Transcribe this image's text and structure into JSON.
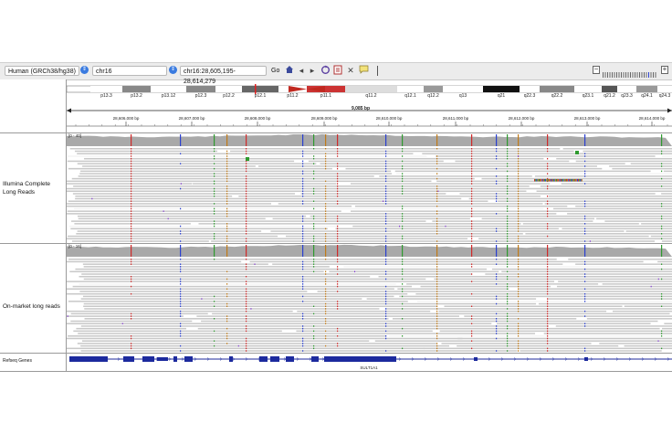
{
  "toolbar": {
    "genome": "Human (GRCh38/hg38)",
    "chromosome": "chr16",
    "locus": "chr16:28,605,195-28,614,279",
    "go_label": "Go"
  },
  "ideogram": {
    "bands": [
      "p13.3",
      "p13.2",
      "p13.12",
      "p12.3",
      "p12.2",
      "p12.1",
      "p11.2",
      "p11.1",
      "q11.2",
      "q12.1",
      "q12.2",
      "q13",
      "q21",
      "q22.3",
      "q22.2",
      "q23.1",
      "q21.2",
      "q23.3",
      "q24.1",
      "q24.3"
    ]
  },
  "ruler": {
    "span_label": "9,085 bp",
    "ticks": [
      "28,606,000 bp",
      "28,607,000 bp",
      "28,608,000 bp",
      "28,609,000 bp",
      "28,610,000 bp",
      "28,611,000 bp",
      "28,612,000 bp",
      "28,613,000 bp",
      "28,614,000 bp"
    ]
  },
  "tracks": [
    {
      "label": "Illumina Complete Long Reads",
      "coverage_range": "[0 - 40]"
    },
    {
      "label": "On-market long reads",
      "coverage_range": "[0 - 16]"
    }
  ],
  "gene_track": {
    "label": "Refseq Genes",
    "gene_name": "SULT1A1",
    "color": "#1c2a9e"
  },
  "colors": {
    "coverage": "#a9a9a9",
    "read": "#c8c8c8",
    "snv_a": "#2f9a2f",
    "snv_c": "#2a3fd0",
    "snv_g": "#c07a18",
    "snv_t": "#d02a2a",
    "insertion": "#7a2ad0"
  }
}
